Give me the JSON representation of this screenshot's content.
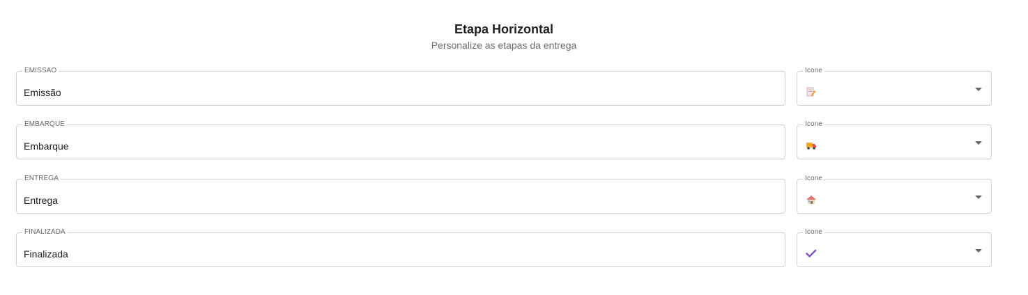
{
  "header": {
    "title": "Etapa Horizontal",
    "subtitle": "Personalize as etapas da entrega"
  },
  "steps": [
    {
      "label": "EMISSAO",
      "value": "Emissão",
      "icon_label": "Icone",
      "icon": "document-pencil-icon"
    },
    {
      "label": "EMBARQUE",
      "value": "Embarque",
      "icon_label": "Icone",
      "icon": "truck-icon"
    },
    {
      "label": "ENTREGA",
      "value": "Entrega",
      "icon_label": "Icone",
      "icon": "house-icon"
    },
    {
      "label": "FINALIZADA",
      "value": "Finalizada",
      "icon_label": "Icone",
      "icon": "check-icon"
    }
  ],
  "colors": {
    "border": "#d0d0d0",
    "check": "#7e57c2",
    "truck": "#f5a623",
    "house": "#e57373"
  }
}
